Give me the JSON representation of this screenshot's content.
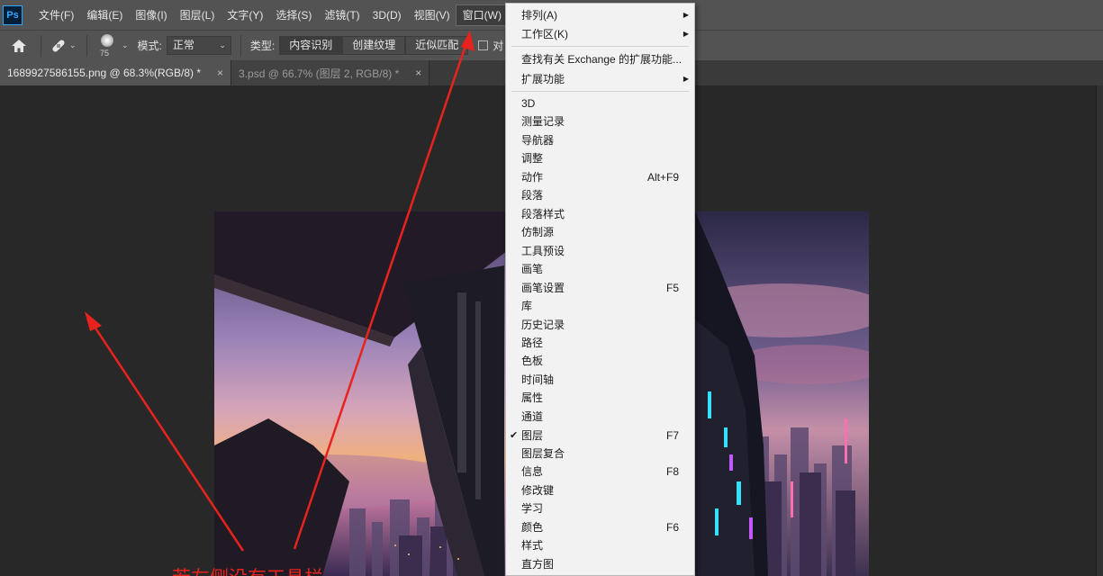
{
  "app": {
    "logo": "Ps"
  },
  "menubar": {
    "items": [
      "文件(F)",
      "编辑(E)",
      "图像(I)",
      "图层(L)",
      "文字(Y)",
      "选择(S)",
      "滤镜(T)",
      "3D(D)",
      "视图(V)",
      "窗口(W)"
    ]
  },
  "options": {
    "brush_size": "75",
    "mode_label": "模式:",
    "mode_value": "正常",
    "type_label": "类型:",
    "type_buttons": [
      "内容识别",
      "创建纹理",
      "近似匹配"
    ],
    "sample_label": "对"
  },
  "tabs": [
    {
      "title": "1689927586155.png @ 68.3%(RGB/8) *",
      "close": "×"
    },
    {
      "title": "3.psd @ 66.7% (图层 2, RGB/8) *",
      "close": "×"
    }
  ],
  "window_menu": {
    "items": [
      {
        "label": "排列(A)",
        "submenu": true
      },
      {
        "label": "工作区(K)",
        "submenu": true
      },
      {
        "label": "查找有关 Exchange 的扩展功能..."
      },
      {
        "label": "扩展功能",
        "submenu": true
      },
      {
        "label": "3D"
      },
      {
        "label": "测量记录"
      },
      {
        "label": "导航器"
      },
      {
        "label": "调整"
      },
      {
        "label": "动作",
        "shortcut": "Alt+F9"
      },
      {
        "label": "段落"
      },
      {
        "label": "段落样式"
      },
      {
        "label": "仿制源"
      },
      {
        "label": "工具预设"
      },
      {
        "label": "画笔"
      },
      {
        "label": "画笔设置",
        "shortcut": "F5"
      },
      {
        "label": "库"
      },
      {
        "label": "历史记录"
      },
      {
        "label": "路径"
      },
      {
        "label": "色板"
      },
      {
        "label": "时间轴"
      },
      {
        "label": "属性"
      },
      {
        "label": "通道"
      },
      {
        "label": "图层",
        "shortcut": "F7",
        "checked": true
      },
      {
        "label": "图层复合"
      },
      {
        "label": "信息",
        "shortcut": "F8"
      },
      {
        "label": "修改键"
      },
      {
        "label": "学习"
      },
      {
        "label": "颜色",
        "shortcut": "F6"
      },
      {
        "label": "样式"
      },
      {
        "label": "直方图"
      }
    ]
  },
  "annotation": {
    "caption": "若左侧没有工具栏",
    "color": "#e8231d"
  }
}
